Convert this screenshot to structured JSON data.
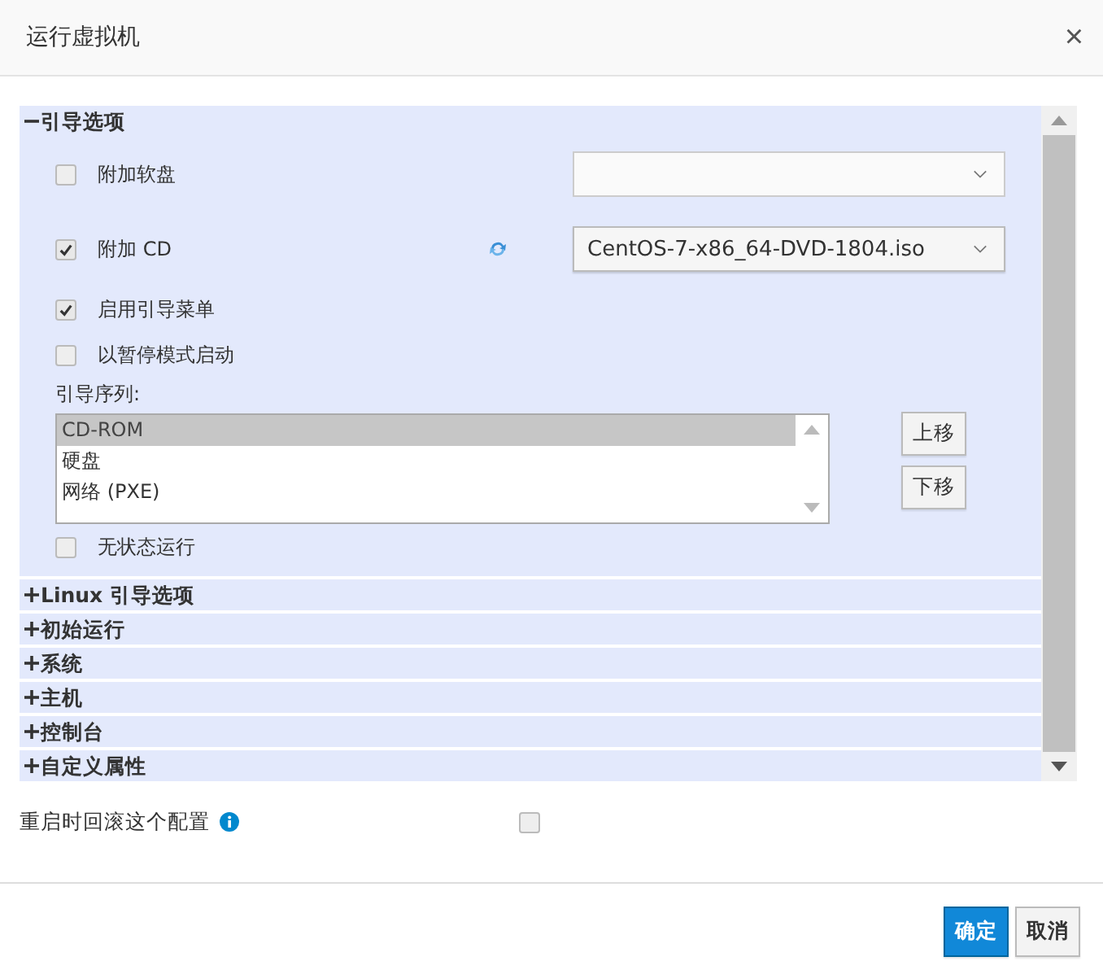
{
  "window": {
    "title": "运行虚拟机",
    "close": "×"
  },
  "sections": [
    {
      "title": "引导选项",
      "expanded": true
    },
    {
      "title": "Linux 引导选项",
      "expanded": false
    },
    {
      "title": "初始运行",
      "expanded": false
    },
    {
      "title": "系统",
      "expanded": false
    },
    {
      "title": "主机",
      "expanded": false
    },
    {
      "title": "控制台",
      "expanded": false
    },
    {
      "title": "自定义属性",
      "expanded": false
    }
  ],
  "boot_options": {
    "options": [
      {
        "label": "附加软盘",
        "checked": false,
        "kind": "select"
      },
      {
        "label": "附加 CD",
        "checked": true,
        "kind": "select",
        "value": "CentOS-7-x86_64-DVD-1804.iso",
        "refresh": true
      },
      {
        "label": "启用引导菜单",
        "checked": true,
        "kind": "plain"
      },
      {
        "label": "以暂停模式启动",
        "checked": false,
        "kind": "plain"
      }
    ],
    "boot_sequence_label": "引导序列:",
    "boot_sequence": [
      {
        "label": "CD-ROM",
        "selected": true
      },
      {
        "label": "硬盘",
        "selected": false
      },
      {
        "label": "网络 (PXE)",
        "selected": false
      }
    ],
    "move_buttons": [
      "上移",
      "下移"
    ],
    "stateless": {
      "label": "无状态运行",
      "checked": false
    }
  },
  "rollback": {
    "label": "重启时回滚这个配置",
    "checked": false
  },
  "buttons": [
    {
      "label": "确定",
      "kind": "primary"
    },
    {
      "label": "取消",
      "kind": "default"
    }
  ]
}
